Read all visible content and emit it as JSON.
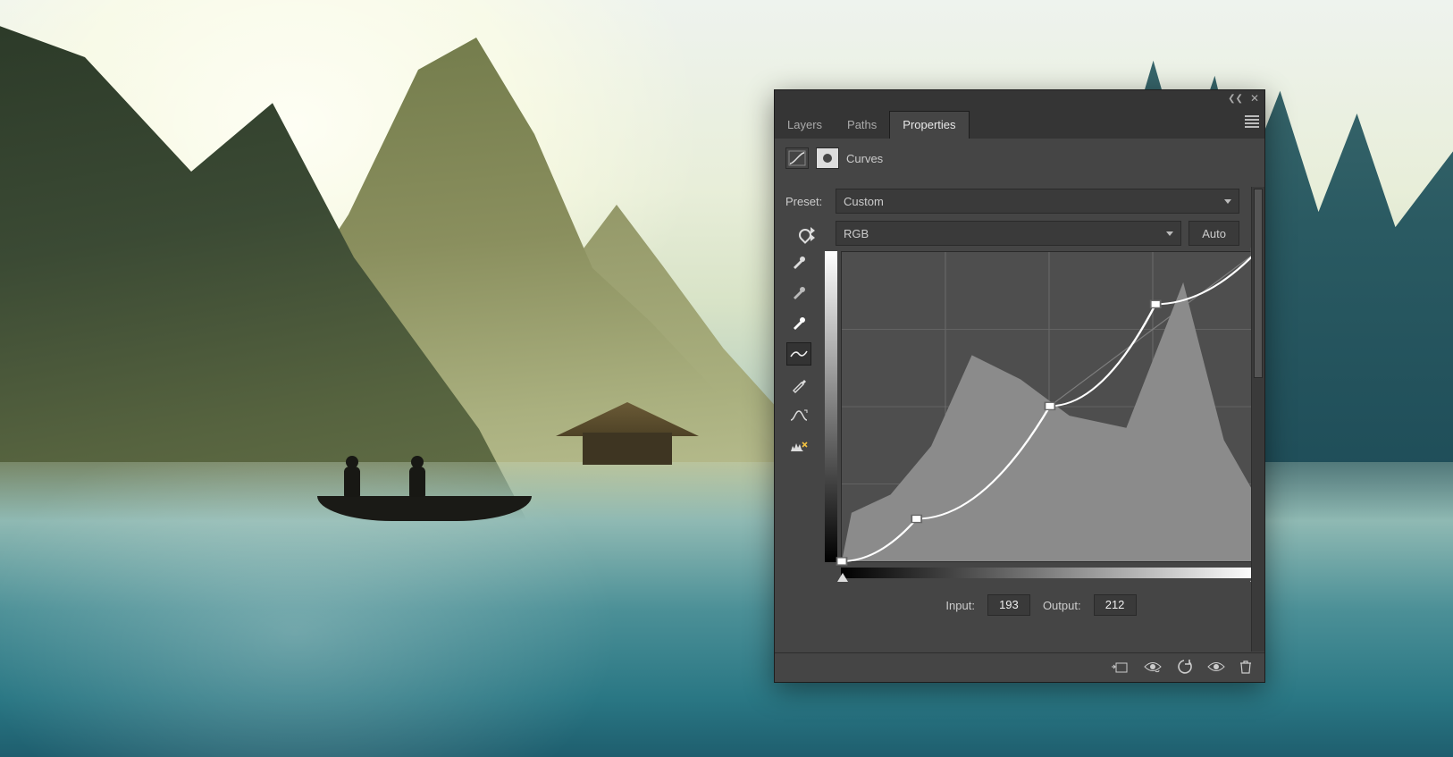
{
  "tabs": {
    "layers": "Layers",
    "paths": "Paths",
    "properties": "Properties"
  },
  "adjustment_name": "Curves",
  "preset_label": "Preset:",
  "preset_value": "Custom",
  "channel_value": "RGB",
  "auto_label": "Auto",
  "input_label": "Input:",
  "input_value": "193",
  "output_label": "Output:",
  "output_value": "212",
  "chart_data": {
    "type": "line",
    "title": "Curves",
    "xlabel": "Input",
    "ylabel": "Output",
    "xlim": [
      0,
      255
    ],
    "ylim": [
      0,
      255
    ],
    "series": [
      {
        "name": "RGB curve",
        "points": [
          {
            "x": 0,
            "y": 0
          },
          {
            "x": 46,
            "y": 35
          },
          {
            "x": 128,
            "y": 128
          },
          {
            "x": 193,
            "y": 212
          },
          {
            "x": 255,
            "y": 255
          }
        ]
      }
    ],
    "histogram_peaks": [
      {
        "x": 6,
        "y": 40
      },
      {
        "x": 30,
        "y": 55
      },
      {
        "x": 55,
        "y": 95
      },
      {
        "x": 80,
        "y": 170
      },
      {
        "x": 110,
        "y": 150
      },
      {
        "x": 140,
        "y": 120
      },
      {
        "x": 175,
        "y": 110
      },
      {
        "x": 210,
        "y": 230
      },
      {
        "x": 235,
        "y": 100
      },
      {
        "x": 252,
        "y": 60
      }
    ]
  }
}
